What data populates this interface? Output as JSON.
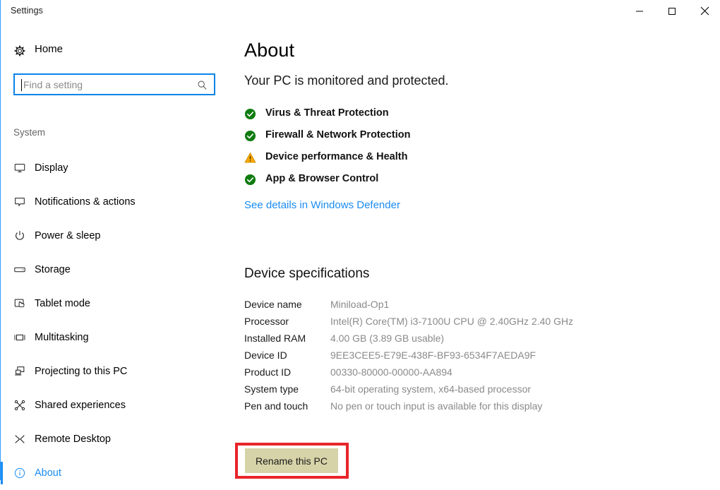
{
  "window": {
    "title": "Settings",
    "controls": [
      {
        "name": "minimize-button",
        "glyph": "minimize"
      },
      {
        "name": "maximize-button",
        "glyph": "maximize"
      },
      {
        "name": "close-button",
        "glyph": "close"
      }
    ]
  },
  "sidebar": {
    "home_label": "Home",
    "home_icon": "gear-icon",
    "search": {
      "placeholder": "Find a setting",
      "value": "",
      "icon": "search-icon"
    },
    "section_label": "System",
    "items": [
      {
        "label": "Display",
        "icon": "monitor-icon",
        "selected": false
      },
      {
        "label": "Notifications & actions",
        "icon": "notification-bubble-icon",
        "selected": false
      },
      {
        "label": "Power & sleep",
        "icon": "power-icon",
        "selected": false
      },
      {
        "label": "Storage",
        "icon": "storage-drive-icon",
        "selected": false
      },
      {
        "label": "Tablet mode",
        "icon": "tablet-hand-icon",
        "selected": false
      },
      {
        "label": "Multitasking",
        "icon": "multitasking-icon",
        "selected": false
      },
      {
        "label": "Projecting to this PC",
        "icon": "projecting-icon",
        "selected": false
      },
      {
        "label": "Shared experiences",
        "icon": "shared-experiences-icon",
        "selected": false
      },
      {
        "label": "Remote Desktop",
        "icon": "remote-desktop-icon",
        "selected": false
      },
      {
        "label": "About",
        "icon": "info-circle-icon",
        "selected": true
      }
    ]
  },
  "main": {
    "page_title": "About",
    "subtitle": "Your PC is monitored and protected.",
    "status_items": [
      {
        "label": "Virus & Threat Protection",
        "icon": "green-check-icon",
        "state": "ok"
      },
      {
        "label": "Firewall & Network Protection",
        "icon": "green-check-icon",
        "state": "ok"
      },
      {
        "label": "Device performance & Health",
        "icon": "warning-triangle-icon",
        "state": "warning"
      },
      {
        "label": "App & Browser Control",
        "icon": "green-check-icon",
        "state": "ok"
      }
    ],
    "defender_link": "See details in Windows Defender",
    "specs_title": "Device specifications",
    "specs": [
      {
        "label": "Device name",
        "value": "Miniload-Op1"
      },
      {
        "label": "Processor",
        "value": "Intel(R) Core(TM) i3-7100U CPU @ 2.40GHz   2.40 GHz"
      },
      {
        "label": "Installed RAM",
        "value": "4.00 GB (3.89 GB usable)"
      },
      {
        "label": "Device ID",
        "value": "9EE3CEE5-E79E-438F-BF93-6534F7AEDA9F"
      },
      {
        "label": "Product ID",
        "value": "00330-80000-00000-AA894"
      },
      {
        "label": "System type",
        "value": "64-bit operating system, x64-based processor"
      },
      {
        "label": "Pen and touch",
        "value": "No pen or touch input is available for this display"
      }
    ],
    "rename_button": "Rename this PC"
  },
  "colors": {
    "accent_blue": "#1a8cf0",
    "focus_blue": "#0a84e8",
    "status_ok_green": "#107c10",
    "status_warning_amber": "#f7a800",
    "annotation_red": "#e8252a",
    "button_fill": "#d6d3a8"
  }
}
